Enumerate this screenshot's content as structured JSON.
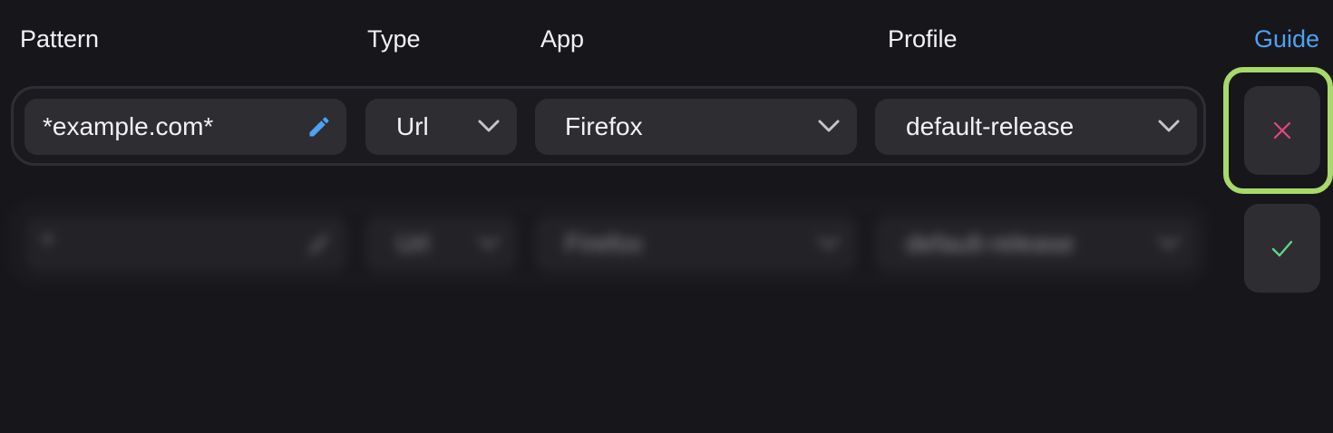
{
  "header": {
    "pattern_label": "Pattern",
    "type_label": "Type",
    "app_label": "App",
    "profile_label": "Profile",
    "guide_link": "Guide"
  },
  "rows": [
    {
      "pattern": "*example.com*",
      "type": "Url",
      "app": "Firefox",
      "profile": "default-release"
    },
    {
      "pattern": "*",
      "type": "Url",
      "app": "Firefox",
      "profile": "default-release"
    }
  ],
  "actions": {
    "remove_icon": "close-icon",
    "confirm_icon": "check-icon"
  },
  "colors": {
    "background": "#17171b",
    "field": "#2d2d32",
    "accent_blue": "#4ea1f3",
    "remove_pink": "#e8457d",
    "confirm_green": "#5fd38a",
    "highlight": "#a9d86b"
  }
}
